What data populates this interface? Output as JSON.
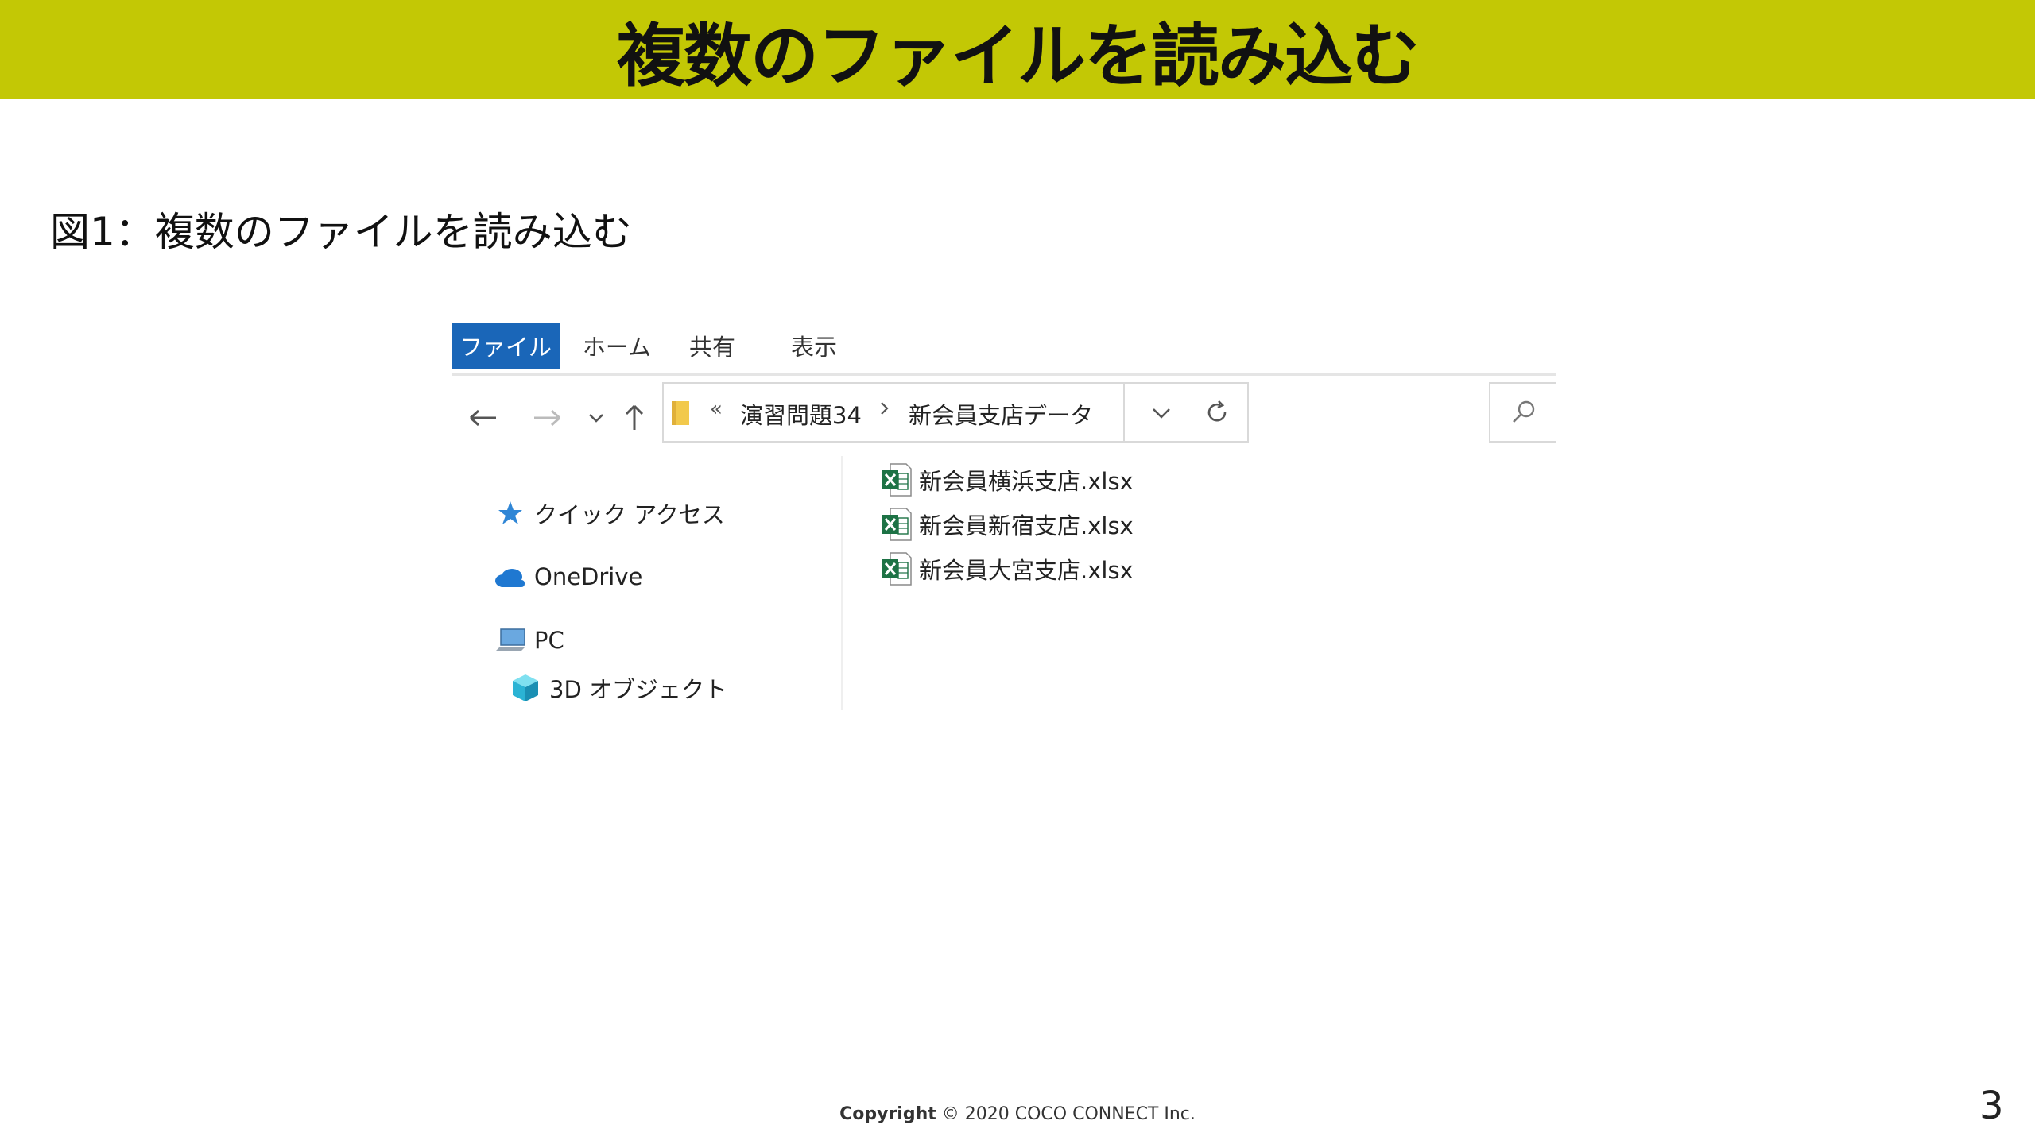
{
  "slide": {
    "title": "複数のファイルを読み込む",
    "figure_caption": "図1：複数のファイルを読み込む",
    "page_number": "3"
  },
  "footer": {
    "copyright_label": "Copyright",
    "copyright_text": " © 2020 COCO CONNECT Inc."
  },
  "explorer": {
    "ribbon_tabs": [
      {
        "label": "ファイル",
        "active": true
      },
      {
        "label": "ホーム",
        "active": false
      },
      {
        "label": "共有",
        "active": false
      },
      {
        "label": "表示",
        "active": false
      }
    ],
    "address": {
      "overflow_chevrons": "«",
      "crumbs": [
        "演習問題34",
        "新会員支店データ"
      ]
    },
    "nav_pane": [
      {
        "label": "クイック アクセス",
        "icon": "star-icon"
      },
      {
        "label": "OneDrive",
        "icon": "cloud-icon"
      },
      {
        "label": "PC",
        "icon": "computer-icon"
      },
      {
        "label": "3D オブジェクト",
        "icon": "cube-icon"
      }
    ],
    "files": [
      {
        "name": "新会員横浜支店.xlsx",
        "icon": "excel-file-icon"
      },
      {
        "name": "新会員新宿支店.xlsx",
        "icon": "excel-file-icon"
      },
      {
        "name": "新会員大宮支店.xlsx",
        "icon": "excel-file-icon"
      }
    ]
  },
  "colors": {
    "title_bar": "#c3c805",
    "active_tab": "#1a66b8",
    "excel_green": "#1d7245",
    "folder_yellow": "#f2c94c"
  }
}
